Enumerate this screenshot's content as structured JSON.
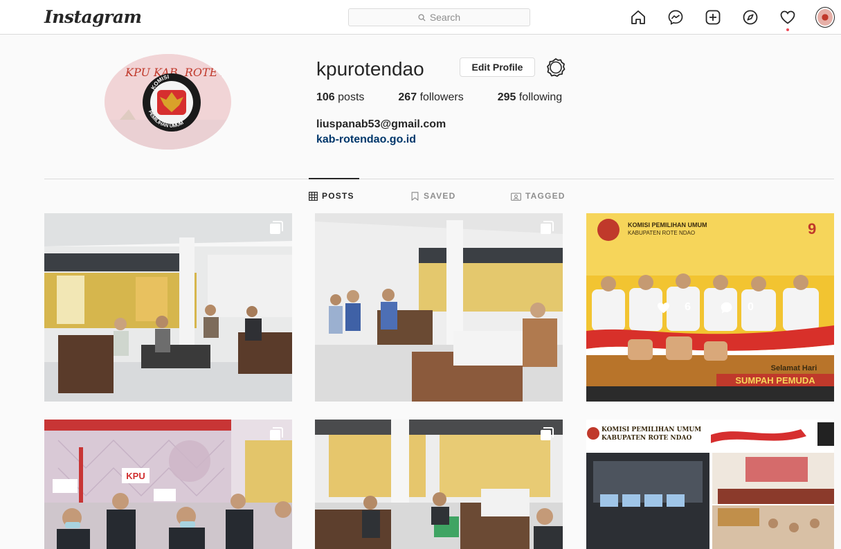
{
  "header": {
    "logo": "Instagram",
    "search_placeholder": "Search",
    "nav_icons": [
      "home-icon",
      "messenger-icon",
      "new-post-icon",
      "explore-icon",
      "activity-heart-icon",
      "profile-avatar"
    ]
  },
  "profile": {
    "username": "kpurotendao",
    "edit_button": "Edit Profile",
    "posts_count": "106",
    "posts_label": "posts",
    "followers_count": "267",
    "followers_label": "followers",
    "following_count": "295",
    "following_label": "following",
    "email": "liuspanab53@gmail.com",
    "website": "kab-rotendao.go.id",
    "avatar_text_top": "KPU KAB. ROTE N",
    "avatar_text_ring_top": "KOMISI",
    "avatar_text_ring_bottom": "PEMILIHAN UMUM"
  },
  "tabs": [
    {
      "label": "POSTS",
      "active": true
    },
    {
      "label": "SAVED",
      "active": false
    },
    {
      "label": "TAGGED",
      "active": false
    }
  ],
  "posts": [
    {
      "kind": "office-meeting",
      "multi": true
    },
    {
      "kind": "office-meeting",
      "multi": true
    },
    {
      "kind": "sumpah-pemuda",
      "multi": false,
      "likes": "6",
      "comments": "0",
      "banner_title": "KOMISI PEMILIHAN UMUM",
      "banner_subtitle": "KABUPATEN ROTE NDAO",
      "greeting": "Selamat Hari",
      "event": "SUMPAH PEMUDA"
    },
    {
      "kind": "kpu-backdrop",
      "multi": true,
      "backdrop_text": "KPU"
    },
    {
      "kind": "office-meeting",
      "multi": true
    },
    {
      "kind": "zoom-collage",
      "multi": false,
      "banner_title": "KOMISI PEMILIHAN UMUM",
      "banner_subtitle": "KABUPATEN ROTE NDAO"
    }
  ],
  "colors": {
    "link": "#00376b",
    "border": "#dbdbdb",
    "muted": "#8e8e8e",
    "notification": "#ed4956"
  }
}
